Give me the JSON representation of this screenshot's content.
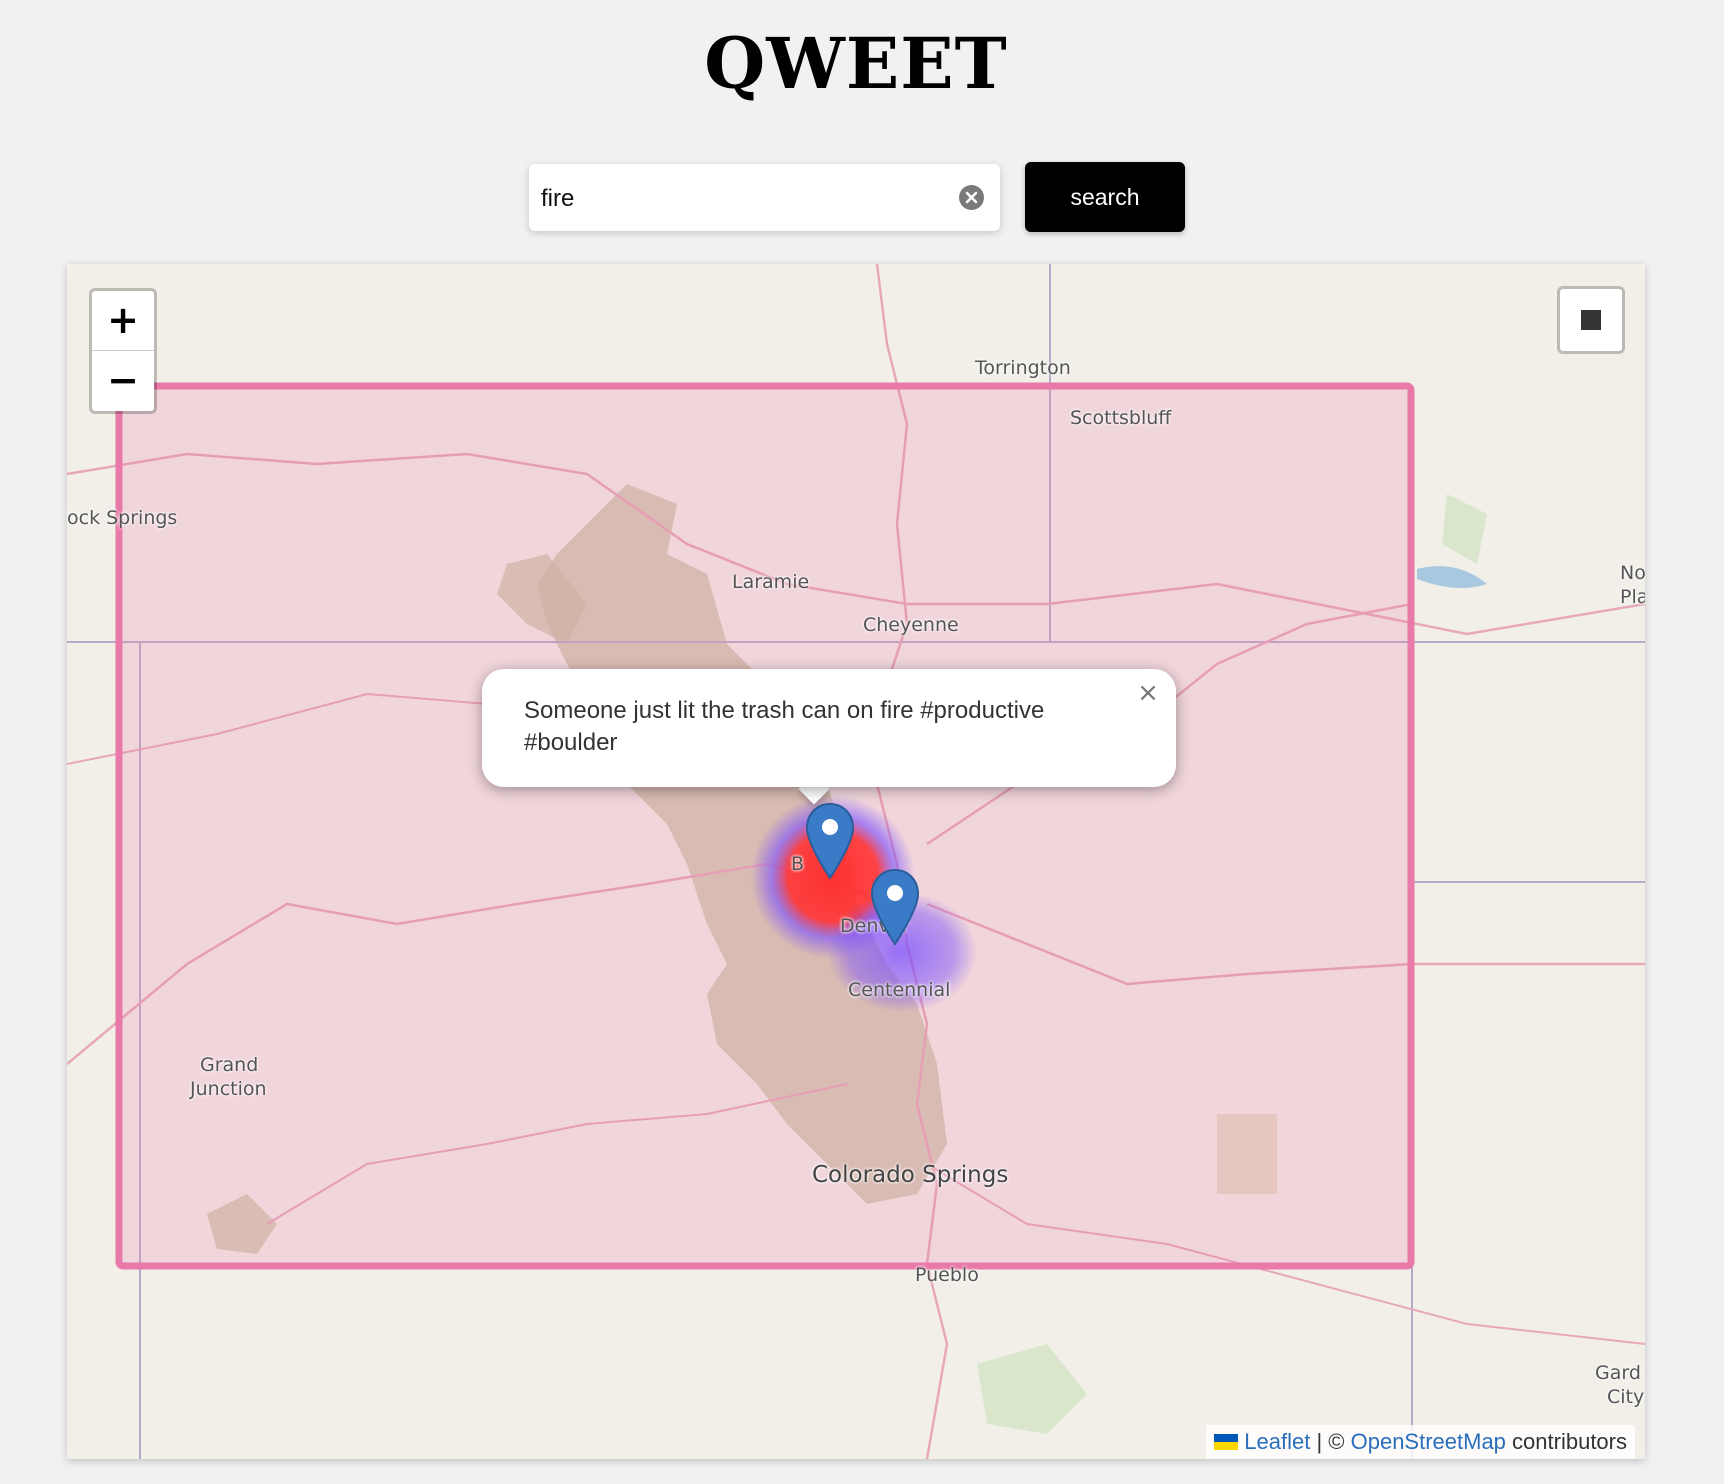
{
  "app": {
    "title": "QWEET"
  },
  "search": {
    "value": "fire",
    "button_label": "search",
    "clear_icon": "clear-circle-icon"
  },
  "map": {
    "zoom_in_label": "+",
    "zoom_out_label": "−",
    "draw_control_icon": "square-draw-icon",
    "labels": {
      "torrington": "Torrington",
      "scottsbluff": "Scottsbluff",
      "rock_springs": "ock Springs",
      "laramie": "Laramie",
      "cheyenne": "Cheyenne",
      "north_platte_1": "No",
      "north_platte_2": "Pla",
      "boulder": "B",
      "denver": "Denver",
      "centennial": "Centennial",
      "grand_junction_1": "Grand",
      "grand_junction_2": "Junction",
      "colorado_springs": "Colorado Springs",
      "pueblo": "Pueblo",
      "garden_city_1": "Gard",
      "garden_city_2": "City"
    },
    "bounding_box_color": "#e879a8",
    "heatmap_colors": [
      "#ff2a2a",
      "#7a4dff"
    ],
    "marker_color": "#3a7bc8"
  },
  "popup": {
    "text": "Someone just lit the trash can on fire #productive #boulder",
    "close_label": "×"
  },
  "attribution": {
    "leaflet": "Leaflet",
    "separator": "| ©",
    "osm": "OpenStreetMap",
    "suffix": "contributors"
  }
}
